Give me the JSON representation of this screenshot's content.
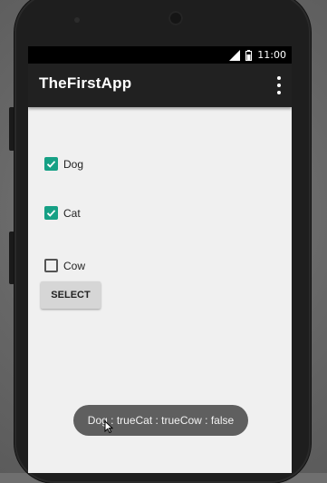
{
  "status_bar": {
    "time": "11:00",
    "network": "3G"
  },
  "app_bar": {
    "title": "TheFirstApp",
    "overflow_icon": "more-vert-icon"
  },
  "checkboxes": [
    {
      "label": "Dog",
      "checked": true
    },
    {
      "label": "Cat",
      "checked": true
    },
    {
      "label": "Cow",
      "checked": false
    }
  ],
  "select_button": {
    "label": "SELECT"
  },
  "toast": {
    "text": "Dog : trueCat : trueCow : false"
  },
  "colors": {
    "app_bar": "#212121",
    "checkbox_accent": "#16a085",
    "screen_background": "#f0f0f0",
    "toast_background": "#5f5f5f"
  }
}
